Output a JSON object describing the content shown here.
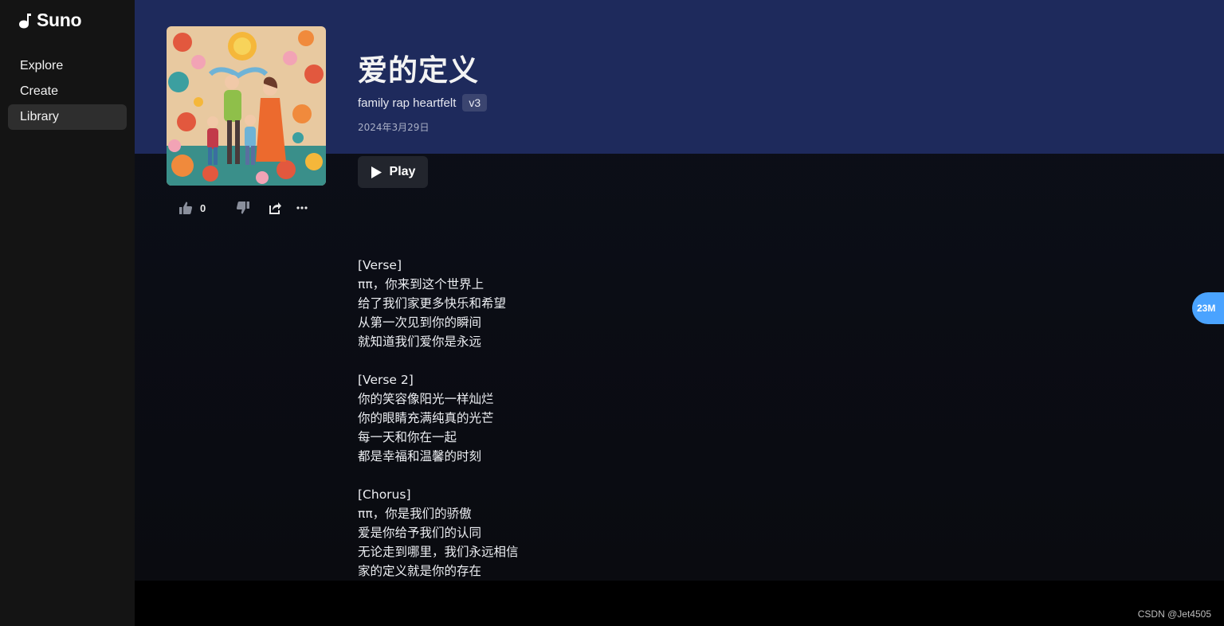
{
  "brand": {
    "name": "Suno"
  },
  "sidebar": {
    "items": [
      {
        "label": "Explore",
        "active": false
      },
      {
        "label": "Create",
        "active": false
      },
      {
        "label": "Library",
        "active": true
      }
    ]
  },
  "song": {
    "title": "爱的定义",
    "tags": "family rap heartfelt",
    "version": "v3",
    "date": "2024年3月29日",
    "play_label": "Play",
    "like_count": "0",
    "lyrics": [
      "[Verse]",
      "ππ，你来到这个世界上",
      "给了我们家更多快乐和希望",
      "从第一次见到你的瞬间",
      "就知道我们爱你是永远",
      "",
      "[Verse 2]",
      "你的笑容像阳光一样灿烂",
      "你的眼睛充满纯真的光芒",
      "每一天和你在一起",
      "都是幸福和温馨的时刻",
      "",
      "[Chorus]",
      "ππ，你是我们的骄傲",
      "爱是你给予我们的认同",
      "无论走到哪里，我们永远相信",
      "家的定义就是你的存在"
    ]
  },
  "floating_badge": "23M",
  "watermark": "CSDN @Jet4505",
  "colors": {
    "hero": "#1e2a5c",
    "sidebar": "#141414",
    "badge": "#4aa3ff",
    "version_chip": "#3b4570"
  }
}
